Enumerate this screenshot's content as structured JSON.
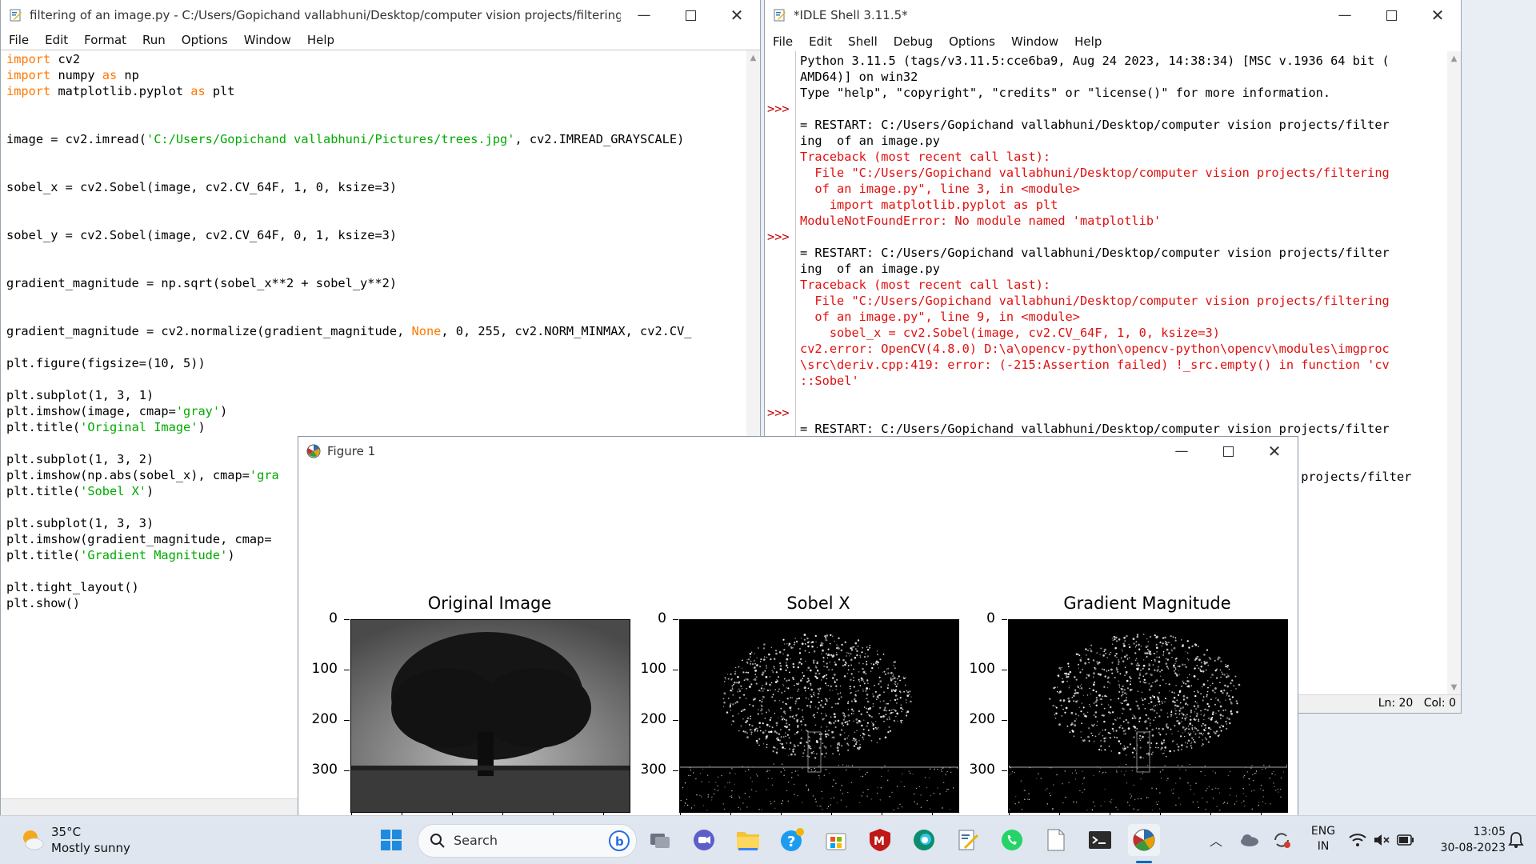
{
  "editor": {
    "title": "filtering  of an image.py - C:/Users/Gopichand vallabhuni/Desktop/computer vision projects/filtering  of an ima...",
    "menu": [
      "File",
      "Edit",
      "Format",
      "Run",
      "Options",
      "Window",
      "Help"
    ],
    "code_lines": [
      [
        {
          "t": "import",
          "c": "kw"
        },
        {
          "t": " cv2"
        }
      ],
      [
        {
          "t": "import",
          "c": "kw"
        },
        {
          "t": " numpy "
        },
        {
          "t": "as",
          "c": "kw"
        },
        {
          "t": " np"
        }
      ],
      [
        {
          "t": "import",
          "c": "kw"
        },
        {
          "t": " matplotlib.pyplot "
        },
        {
          "t": "as",
          "c": "kw"
        },
        {
          "t": " plt"
        }
      ],
      [],
      [],
      [
        {
          "t": "image = cv2.imread("
        },
        {
          "t": "'C:/Users/Gopichand vallabhuni/Pictures/trees.jpg'",
          "c": "str"
        },
        {
          "t": ", cv2.IMREAD_GRAYSCALE)"
        }
      ],
      [],
      [],
      [
        {
          "t": "sobel_x = cv2.Sobel(image, cv2.CV_64F, 1, 0, ksize=3)"
        }
      ],
      [],
      [],
      [
        {
          "t": "sobel_y = cv2.Sobel(image, cv2.CV_64F, 0, 1, ksize=3)"
        }
      ],
      [],
      [],
      [
        {
          "t": "gradient_magnitude = np.sqrt(sobel_x**2 + sobel_y**2)"
        }
      ],
      [],
      [],
      [
        {
          "t": "gradient_magnitude = cv2.normalize(gradient_magnitude, "
        },
        {
          "t": "None",
          "c": "kw"
        },
        {
          "t": ", 0, 255, cv2.NORM_MINMAX, cv2.CV_"
        }
      ],
      [],
      [
        {
          "t": "plt.figure(figsize=(10, 5))"
        }
      ],
      [],
      [
        {
          "t": "plt.subplot(1, 3, 1)"
        }
      ],
      [
        {
          "t": "plt.imshow(image, cmap="
        },
        {
          "t": "'gray'",
          "c": "str"
        },
        {
          "t": ")"
        }
      ],
      [
        {
          "t": "plt.title("
        },
        {
          "t": "'Original Image'",
          "c": "str"
        },
        {
          "t": ")"
        }
      ],
      [],
      [
        {
          "t": "plt.subplot(1, 3, 2)"
        }
      ],
      [
        {
          "t": "plt.imshow(np.abs(sobel_x), cmap="
        },
        {
          "t": "'gra",
          "c": "str"
        }
      ],
      [
        {
          "t": "plt.title("
        },
        {
          "t": "'Sobel X'",
          "c": "str"
        },
        {
          "t": ")"
        }
      ],
      [],
      [
        {
          "t": "plt.subplot(1, 3, 3)"
        }
      ],
      [
        {
          "t": "plt.imshow(gradient_magnitude, cmap="
        }
      ],
      [
        {
          "t": "plt.title("
        },
        {
          "t": "'Gradient Magnitude'",
          "c": "str"
        },
        {
          "t": ")"
        }
      ],
      [],
      [
        {
          "t": "plt.tight_layout()"
        }
      ],
      [
        {
          "t": "plt.show()"
        }
      ]
    ]
  },
  "shell": {
    "title": "*IDLE Shell 3.11.5*",
    "menu": [
      "File",
      "Edit",
      "Shell",
      "Debug",
      "Options",
      "Window",
      "Help"
    ],
    "lines": [
      {
        "p": "",
        "t": "Python 3.11.5 (tags/v3.11.5:cce6ba9, Aug 24 2023, 14:38:34) [MSC v.1936 64 bit (",
        "c": ""
      },
      {
        "p": "",
        "t": "AMD64)] on win32",
        "c": ""
      },
      {
        "p": "",
        "t": "Type \"help\", \"copyright\", \"credits\" or \"license()\" for more information.",
        "c": ""
      },
      {
        "p": ">>>",
        "t": "",
        "c": ""
      },
      {
        "p": "",
        "t": "= RESTART: C:/Users/Gopichand vallabhuni/Desktop/computer vision projects/filter",
        "c": ""
      },
      {
        "p": "",
        "t": "ing  of an image.py",
        "c": ""
      },
      {
        "p": "",
        "t": "Traceback (most recent call last):",
        "c": "err"
      },
      {
        "p": "",
        "t": "  File \"C:/Users/Gopichand vallabhuni/Desktop/computer vision projects/filtering",
        "c": "err"
      },
      {
        "p": "",
        "t": "  of an image.py\", line 3, in <module>",
        "c": "err"
      },
      {
        "p": "",
        "t": "    import matplotlib.pyplot as plt",
        "c": "err"
      },
      {
        "p": "",
        "t": "ModuleNotFoundError: No module named 'matplotlib'",
        "c": "err"
      },
      {
        "p": ">>>",
        "t": "",
        "c": ""
      },
      {
        "p": "",
        "t": "= RESTART: C:/Users/Gopichand vallabhuni/Desktop/computer vision projects/filter",
        "c": ""
      },
      {
        "p": "",
        "t": "ing  of an image.py",
        "c": ""
      },
      {
        "p": "",
        "t": "Traceback (most recent call last):",
        "c": "err"
      },
      {
        "p": "",
        "t": "  File \"C:/Users/Gopichand vallabhuni/Desktop/computer vision projects/filtering",
        "c": "err"
      },
      {
        "p": "",
        "t": "  of an image.py\", line 9, in <module>",
        "c": "err"
      },
      {
        "p": "",
        "t": "    sobel_x = cv2.Sobel(image, cv2.CV_64F, 1, 0, ksize=3)",
        "c": "err"
      },
      {
        "p": "",
        "t": "cv2.error: OpenCV(4.8.0) D:\\a\\opencv-python\\opencv-python\\opencv\\modules\\imgproc",
        "c": "err"
      },
      {
        "p": "",
        "t": "\\src\\deriv.cpp:419: error: (-215:Assertion failed) !_src.empty() in function 'cv",
        "c": "err"
      },
      {
        "p": "",
        "t": "::Sobel'",
        "c": "err"
      },
      {
        "p": "",
        "t": "",
        "c": ""
      },
      {
        "p": ">>>",
        "t": "",
        "c": ""
      },
      {
        "p": "",
        "t": "= RESTART: C:/Users/Gopichand vallabhuni/Desktop/computer vision projects/filter",
        "c": ""
      },
      {
        "p": "",
        "t": "",
        "c": ""
      },
      {
        "p": "",
        "t": "",
        "c": ""
      },
      {
        "p": "",
        "t": "                                                                 on projects/filter",
        "c": ""
      }
    ],
    "status": "Ln: 20   Col: 0"
  },
  "figure": {
    "title": "Figure 1",
    "panels": [
      {
        "title": "Original Image",
        "kind": "original"
      },
      {
        "title": "Sobel X",
        "kind": "edges"
      },
      {
        "title": "Gradient Magnitude",
        "kind": "edges2"
      }
    ],
    "yticks": [
      "0",
      "100",
      "200",
      "300"
    ]
  },
  "taskbar": {
    "weather_temp": "35°C",
    "weather_desc": "Mostly sunny",
    "search_placeholder": "Search",
    "lang_top": "ENG",
    "lang_bottom": "IN",
    "time": "13:05",
    "date": "30-08-2023",
    "colors": {
      "accent": "#0067c0",
      "bg": "#dfe6ef"
    }
  }
}
